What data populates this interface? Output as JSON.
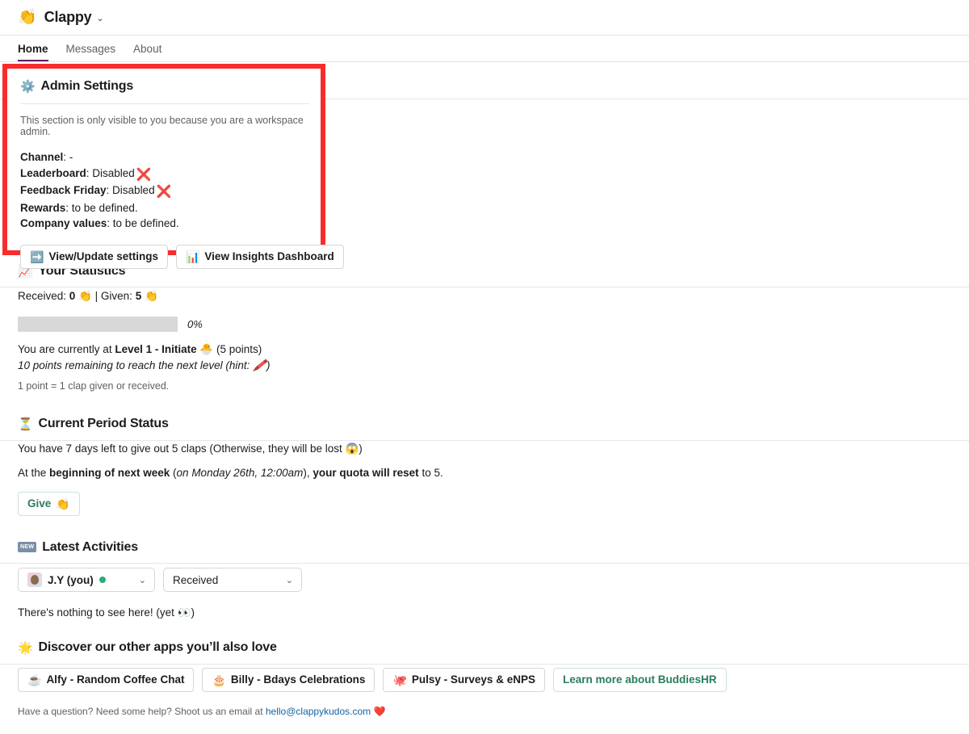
{
  "app": {
    "logo_emoji": "👏",
    "title": "Clappy",
    "chevron": "⌄"
  },
  "tabs": [
    {
      "label": "Home",
      "active": true
    },
    {
      "label": "Messages",
      "active": false
    },
    {
      "label": "About",
      "active": false
    }
  ],
  "admin": {
    "icon": "⚙️",
    "title": "Admin Settings",
    "note": "This section is only visible to you because you are a workspace admin.",
    "rows": [
      {
        "label": "Channel",
        "value": ": -",
        "mark": ""
      },
      {
        "label": "Leaderboard",
        "value": ": Disabled",
        "mark": "❌"
      },
      {
        "label": "Feedback Friday",
        "value": ": Disabled",
        "mark": "❌"
      },
      {
        "label": "Rewards",
        "value": ": to be defined.",
        "mark": ""
      },
      {
        "label": "Company values",
        "value": ": to be defined.",
        "mark": ""
      }
    ],
    "settings_button": {
      "icon": "➡️",
      "label": "View/Update settings"
    },
    "insights_button": {
      "icon": "📊",
      "label": "View Insights Dashboard"
    },
    "highlight_color": "#f92c2c"
  },
  "stats": {
    "icon": "📈",
    "title": "Your Statistics",
    "received_label": "Received: ",
    "received_value": "0",
    "received_emoji": "👏",
    "separator": " | ",
    "given_label": "Given: ",
    "given_value": "5",
    "given_emoji": "👏",
    "progress_percent": "0%",
    "progress_value": 0,
    "level_prefix": "You are currently at ",
    "level_name": "Level 1 - Initiate",
    "level_emoji": "🐣",
    "level_points": " (5 points)",
    "hint_text": "10 points remaining to reach the next level (hint: ",
    "hint_emoji": "🖍️",
    "hint_suffix": ")",
    "footnote": "1 point = 1 clap given or received."
  },
  "period": {
    "icon": "⏳",
    "title": "Current Period Status",
    "line1_a": "You have 7 days left to give out 5 claps (Otherwise, they will be lost ",
    "line1_emoji": "😱",
    "line1_b": ")",
    "line2_a": "At the ",
    "line2_bold1": "beginning of next week",
    "line2_b": " (",
    "line2_italic": "on Monday 26th, 12:00am",
    "line2_c": "), ",
    "line2_bold2": "your quota will reset",
    "line2_d": " to 5.",
    "give_button": {
      "label": "Give",
      "emoji": "👏"
    }
  },
  "activities": {
    "badge": "NEW",
    "title": "Latest Activities",
    "user_select": {
      "label": "J.Y (you)",
      "status": "online",
      "chevron": "⌄"
    },
    "kind_select": {
      "label": "Received",
      "chevron": "⌄"
    },
    "empty_text_a": "There's nothing to see here! (yet ",
    "empty_emoji": "👀",
    "empty_text_b": ")"
  },
  "discover": {
    "icon": "🌟",
    "title": "Discover our other apps you’ll also love",
    "apps": [
      {
        "emoji": "☕",
        "label": "Alfy - Random Coffee Chat"
      },
      {
        "emoji": "🎂",
        "label": "Billy - Bdays Celebrations"
      },
      {
        "emoji": "🐙",
        "label": "Pulsy - Surveys & eNPS"
      }
    ],
    "learn_more": "Learn more about BuddiesHR",
    "email_prefix": "Have a question? Need some help? Shoot us an email at ",
    "email": "hello@clappykudos.com",
    "email_emoji": "❤️"
  }
}
